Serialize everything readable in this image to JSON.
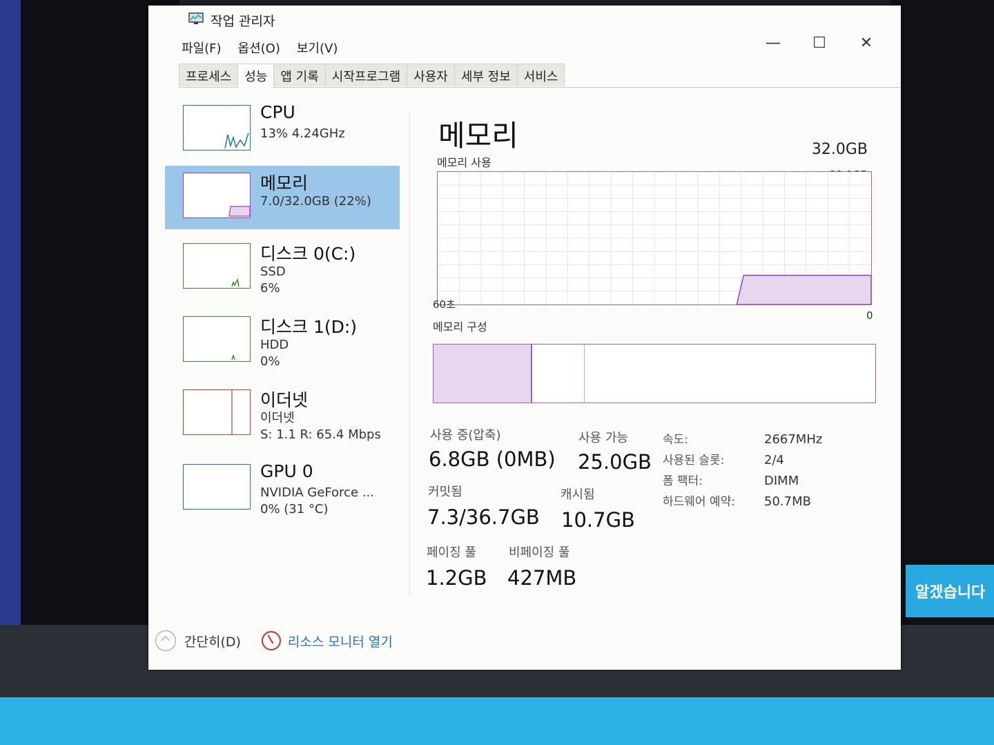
{
  "window": {
    "title": "작업 관리자",
    "controls": {
      "minimize": "—",
      "maximize": "☐",
      "close": "✕"
    }
  },
  "menu": [
    "파일(F)",
    "옵션(O)",
    "보기(V)"
  ],
  "tabs": [
    "프로세스",
    "성능",
    "앱 기록",
    "시작프로그램",
    "사용자",
    "세부 정보",
    "서비스"
  ],
  "sidebar": {
    "items": [
      {
        "title": "CPU",
        "sub1": "13% 4.24GHz",
        "sub2": "",
        "color": "#1e6fbf"
      },
      {
        "title": "메모리",
        "sub1": "7.0/32.0GB (22%)",
        "sub2": "",
        "color": "#9b3fb5"
      },
      {
        "title": "디스크 0(C:)",
        "sub1": "SSD",
        "sub2": "6%",
        "color": "#3d8a2a"
      },
      {
        "title": "디스크 1(D:)",
        "sub1": "HDD",
        "sub2": "0%",
        "color": "#3d8a2a"
      },
      {
        "title": "이더넷",
        "sub1": "이더넷",
        "sub2": "S: 1.1  R: 65.4 Mbps",
        "color": "#b5462b"
      },
      {
        "title": "GPU 0",
        "sub1": "NVIDIA GeForce ...",
        "sub2": "0% (31 °C)",
        "color": "#1e6fbf"
      }
    ]
  },
  "memory": {
    "title": "메모리",
    "total": "32.0GB",
    "usage_label": "메모리 사용",
    "graph_max": "32.0GB",
    "graph_time": "60초",
    "graph_min": "0",
    "usage_fraction": 0.22,
    "composition_label": "메모리 구성",
    "stats": {
      "in_use_label": "사용 중(압축)",
      "in_use": "6.8GB (0MB)",
      "available_label": "사용 가능",
      "available": "25.0GB",
      "committed_label": "커밋됨",
      "committed": "7.3/36.7GB",
      "cached_label": "캐시됨",
      "cached": "10.7GB",
      "paged_label": "페이징 풀",
      "paged": "1.2GB",
      "nonpaged_label": "비페이징 풀",
      "nonpaged": "427MB"
    },
    "specs": [
      {
        "key": "속도:",
        "value": "2667MHz"
      },
      {
        "key": "사용된 슬롯:",
        "value": "2/4"
      },
      {
        "key": "폼 팩터:",
        "value": "DIMM"
      },
      {
        "key": "하드웨어 예약:",
        "value": "50.7MB"
      }
    ]
  },
  "footer": {
    "simple": "간단히(D)",
    "resource_monitor": "리소스 모니터 열기"
  },
  "background": {
    "confirm_button": "알겠습니다"
  }
}
